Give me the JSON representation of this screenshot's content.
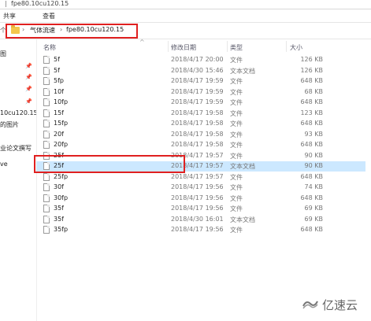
{
  "window": {
    "title": "fpe80.10cu120.15"
  },
  "ribbon": {
    "tabs": [
      "共享",
      "查看"
    ]
  },
  "address": {
    "crumbs": [
      "气体流速",
      "fpe80.10cu120.15"
    ]
  },
  "sidebar": {
    "items": [
      "图",
      "10cu120.15",
      "的图片",
      "业论文撰写",
      "ve"
    ]
  },
  "columns": {
    "name": "名称",
    "date": "修改日期",
    "type": "类型",
    "size": "大小"
  },
  "files": [
    {
      "name": "5f",
      "date": "2018/4/17 20:00",
      "type": "文件",
      "size": "126 KB"
    },
    {
      "name": "5f",
      "date": "2018/4/30 15:46",
      "type": "文本文档",
      "size": "126 KB"
    },
    {
      "name": "5fp",
      "date": "2018/4/17 19:59",
      "type": "文件",
      "size": "648 KB"
    },
    {
      "name": "10f",
      "date": "2018/4/17 19:59",
      "type": "文件",
      "size": "68 KB"
    },
    {
      "name": "10fp",
      "date": "2018/4/17 19:59",
      "type": "文件",
      "size": "648 KB"
    },
    {
      "name": "15f",
      "date": "2018/4/17 19:58",
      "type": "文件",
      "size": "123 KB"
    },
    {
      "name": "15fp",
      "date": "2018/4/17 19:58",
      "type": "文件",
      "size": "648 KB"
    },
    {
      "name": "20f",
      "date": "2018/4/17 19:58",
      "type": "文件",
      "size": "93 KB"
    },
    {
      "name": "20fp",
      "date": "2018/4/17 19:58",
      "type": "文件",
      "size": "648 KB"
    },
    {
      "name": "25f",
      "date": "2018/4/17 19:57",
      "type": "文件",
      "size": "90 KB"
    },
    {
      "name": "25f",
      "date": "2018/4/17 19:57",
      "type": "文本文档",
      "size": "90 KB"
    },
    {
      "name": "25fp",
      "date": "2018/4/17 19:57",
      "type": "文件",
      "size": "648 KB"
    },
    {
      "name": "30f",
      "date": "2018/4/17 19:56",
      "type": "文件",
      "size": "74 KB"
    },
    {
      "name": "30fp",
      "date": "2018/4/17 19:56",
      "type": "文件",
      "size": "648 KB"
    },
    {
      "name": "35f",
      "date": "2018/4/17 19:56",
      "type": "文件",
      "size": "69 KB"
    },
    {
      "name": "35f",
      "date": "2018/4/30 16:01",
      "type": "文本文档",
      "size": "69 KB"
    },
    {
      "name": "35fp",
      "date": "2018/4/17 19:56",
      "type": "文件",
      "size": "648 KB"
    }
  ],
  "selected_index": 10,
  "watermark": {
    "text": "亿速云"
  },
  "colors": {
    "selection": "#cce8ff",
    "highlight_box": "#e02020",
    "folder": "#f3c64c"
  }
}
